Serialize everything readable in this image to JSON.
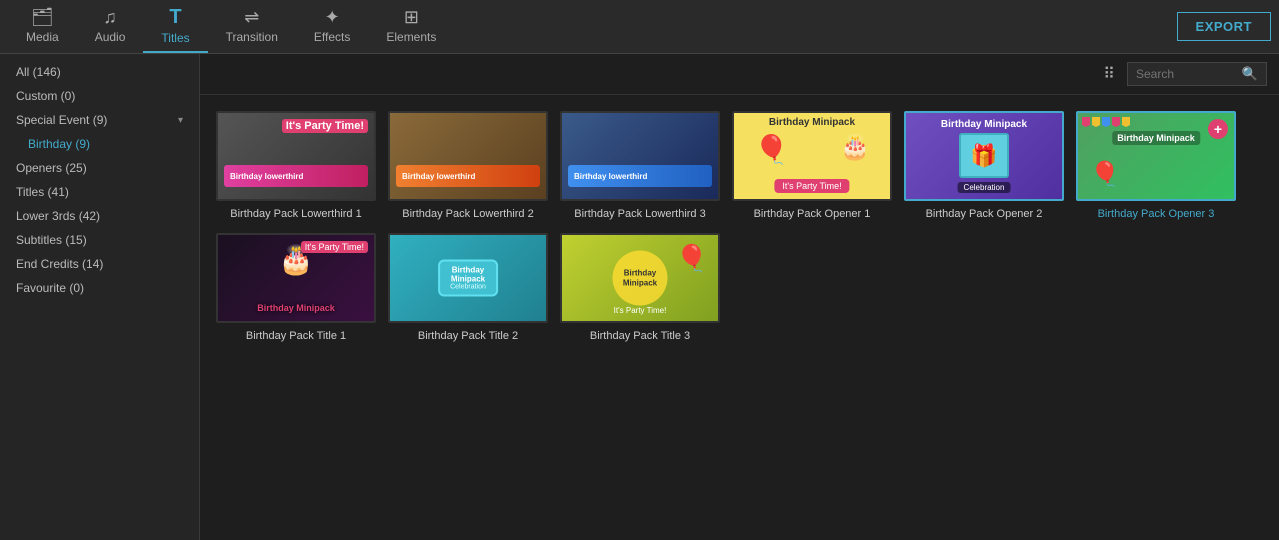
{
  "nav": {
    "items": [
      {
        "id": "media",
        "label": "Media",
        "icon": "🗂",
        "active": false
      },
      {
        "id": "audio",
        "label": "Audio",
        "icon": "♫",
        "active": false
      },
      {
        "id": "titles",
        "label": "Titles",
        "icon": "T",
        "active": true
      },
      {
        "id": "transition",
        "label": "Transition",
        "icon": "⇌",
        "active": false
      },
      {
        "id": "effects",
        "label": "Effects",
        "icon": "✦",
        "active": false
      },
      {
        "id": "elements",
        "label": "Elements",
        "icon": "⊞",
        "active": false
      }
    ],
    "export_label": "EXPORT"
  },
  "sidebar": {
    "items": [
      {
        "id": "all",
        "label": "All (146)",
        "indent": false,
        "active": false
      },
      {
        "id": "custom",
        "label": "Custom (0)",
        "indent": false,
        "active": false
      },
      {
        "id": "special-event",
        "label": "Special Event (9)",
        "indent": false,
        "active": false,
        "collapsible": true
      },
      {
        "id": "birthday",
        "label": "Birthday (9)",
        "indent": true,
        "active": true
      },
      {
        "id": "openers",
        "label": "Openers (25)",
        "indent": false,
        "active": false
      },
      {
        "id": "titles",
        "label": "Titles (41)",
        "indent": false,
        "active": false
      },
      {
        "id": "lower-3rds",
        "label": "Lower 3rds (42)",
        "indent": false,
        "active": false
      },
      {
        "id": "subtitles",
        "label": "Subtitles (15)",
        "indent": false,
        "active": false
      },
      {
        "id": "end-credits",
        "label": "End Credits (14)",
        "indent": false,
        "active": false
      },
      {
        "id": "favourite",
        "label": "Favourite (0)",
        "indent": false,
        "active": false
      }
    ]
  },
  "toolbar": {
    "search_placeholder": "Search"
  },
  "grid": {
    "items": [
      {
        "id": "lowerthird-1",
        "label": "Birthday Pack Lowerthird 1",
        "thumb_type": "dark-photo",
        "lt_color": "pink"
      },
      {
        "id": "lowerthird-2",
        "label": "Birthday Pack Lowerthird 2",
        "thumb_type": "warm-photo",
        "lt_color": "orange"
      },
      {
        "id": "lowerthird-3",
        "label": "Birthday Pack Lowerthird 3",
        "thumb_type": "blue-photo",
        "lt_color": "blue"
      },
      {
        "id": "opener-1",
        "label": "Birthday Pack Opener 1",
        "thumb_type": "yellow",
        "selected": false
      },
      {
        "id": "opener-2",
        "label": "Birthday Pack Opener 2",
        "thumb_type": "purple",
        "selected": true
      },
      {
        "id": "opener-3",
        "label": "Birthday Pack Opener 3",
        "thumb_type": "green",
        "selected": true,
        "label_active": true
      },
      {
        "id": "title-1",
        "label": "Birthday Pack Title 1",
        "thumb_type": "dark-cake"
      },
      {
        "id": "title-2",
        "label": "Birthday Pack Title 2",
        "thumb_type": "teal"
      },
      {
        "id": "title-3",
        "label": "Birthday Pack Title 3",
        "thumb_type": "yellow-green"
      }
    ]
  }
}
